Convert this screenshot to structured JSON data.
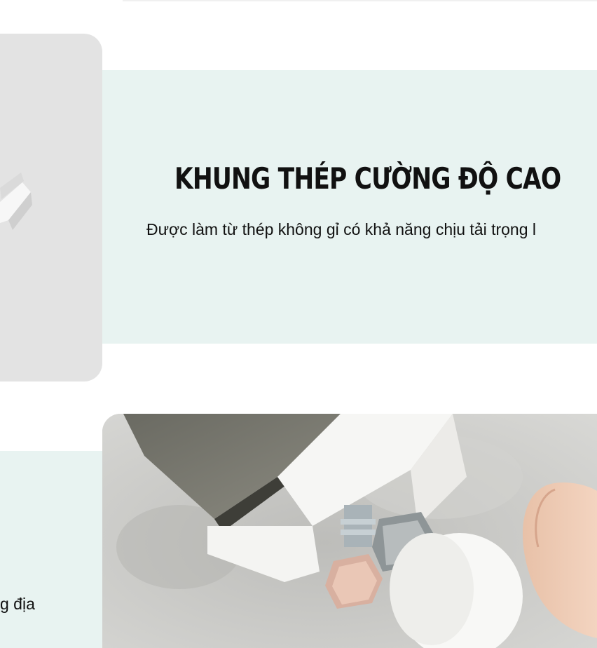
{
  "feature": {
    "title": "KHUNG THÉP CƯỜNG ĐỘ CAO",
    "description": "Được làm từ thép không gỉ có khả năng chịu tải trọng l"
  },
  "lower_feature": {
    "description_fragment": "g địa"
  },
  "colors": {
    "mint_background": "#e8f3f1",
    "gray_card": "#e3e3e3",
    "text": "#111111"
  }
}
